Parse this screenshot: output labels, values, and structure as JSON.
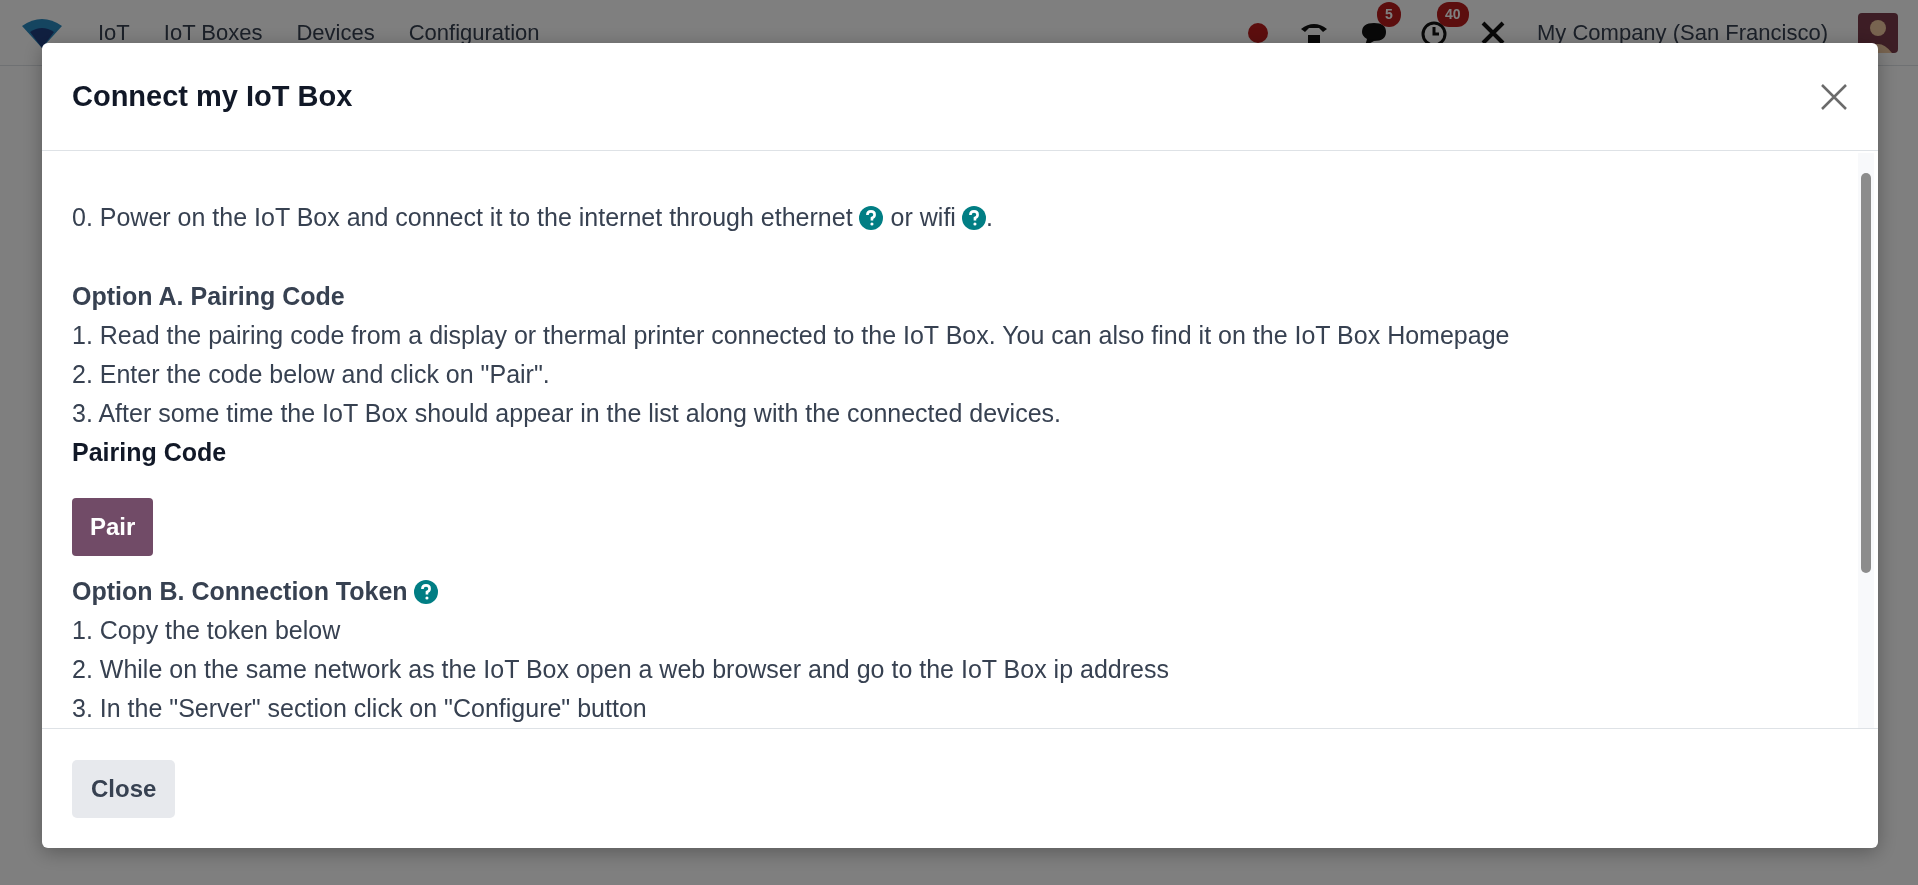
{
  "navbar": {
    "app_name": "IoT",
    "menu": [
      {
        "label": "IoT Boxes"
      },
      {
        "label": "Devices"
      },
      {
        "label": "Configuration"
      }
    ],
    "messages_badge": "5",
    "activities_badge": "40",
    "company": "My Company (San Francisco)"
  },
  "dialog": {
    "title": "Connect my IoT Box",
    "blocks": [
      {
        "kind": "text",
        "segments": [
          {
            "kind": "text",
            "text": "0. Power on the IoT Box and connect it to the internet through ethernet"
          },
          {
            "kind": "help"
          },
          {
            "kind": "text",
            "text": "or wifi"
          },
          {
            "kind": "help"
          },
          {
            "kind": "text",
            "text": "."
          }
        ]
      },
      {
        "kind": "heading",
        "segments": [
          {
            "kind": "text",
            "text": "Option A. Pairing Code"
          }
        ]
      },
      {
        "kind": "line",
        "text": "1. Read the pairing code from a display or thermal printer connected to the IoT Box. You can also find it on the IoT Box Homepage"
      },
      {
        "kind": "line",
        "text": "2. Enter the code below and click on \"Pair\"."
      },
      {
        "kind": "line",
        "text": "3. After some time the IoT Box should appear in the list along with the connected devices."
      },
      {
        "kind": "label",
        "text": "Pairing Code"
      },
      {
        "kind": "button",
        "text": "Pair"
      },
      {
        "kind": "heading",
        "segments": [
          {
            "kind": "text",
            "text": "Option B. Connection Token"
          },
          {
            "kind": "help"
          }
        ]
      },
      {
        "kind": "line",
        "text": "1. Copy the token below"
      },
      {
        "kind": "line",
        "text": "2. While on the same network as the IoT Box open a web browser and go to the IoT Box ip address"
      },
      {
        "kind": "line",
        "text": "3. In the \"Server\" section click on \"Configure\" button"
      }
    ],
    "buttons": [
      {
        "label": "Close"
      }
    ]
  }
}
